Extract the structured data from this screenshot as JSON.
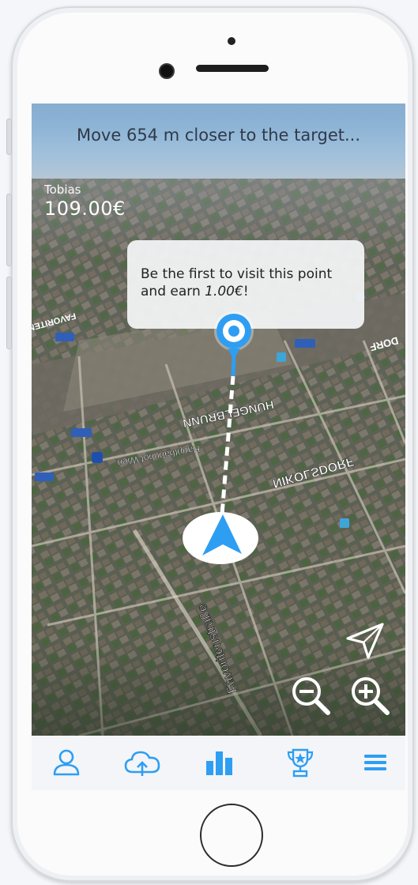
{
  "banner": {
    "text": "Move 654 m closer to the target..."
  },
  "user": {
    "name": "Tobias",
    "balance": "109.00€"
  },
  "bubble": {
    "line1": "Be the first to visit this point",
    "line2_prefix": "and earn ",
    "amount": "1.00€",
    "suffix": "!"
  },
  "map_labels": {
    "favoriten_strasse": "Favoritenstraße",
    "hungelbrunn": "HUNGELBRUNN",
    "nikolsdorf": "NIKOLSDORF",
    "hauptbahnhof": "Hauptbahnhof Wien",
    "favoriten": "FAVORITEN",
    "wieden": "DORF"
  },
  "controls": {
    "zoom_out_icon": "zoom-out-icon",
    "zoom_in_icon": "zoom-in-icon",
    "locate_icon": "navigation-arrow-icon"
  },
  "tabs": [
    {
      "id": "profile",
      "icon": "user-icon"
    },
    {
      "id": "upload",
      "icon": "cloud-upload-icon"
    },
    {
      "id": "stats",
      "icon": "bar-chart-icon"
    },
    {
      "id": "leaderboard",
      "icon": "trophy-icon"
    },
    {
      "id": "menu",
      "icon": "hamburger-menu-icon"
    }
  ],
  "colors": {
    "accent": "#2e9ef2",
    "tab_bg": "#f3f5f8",
    "bubble_bg": "#f0f1f3"
  }
}
